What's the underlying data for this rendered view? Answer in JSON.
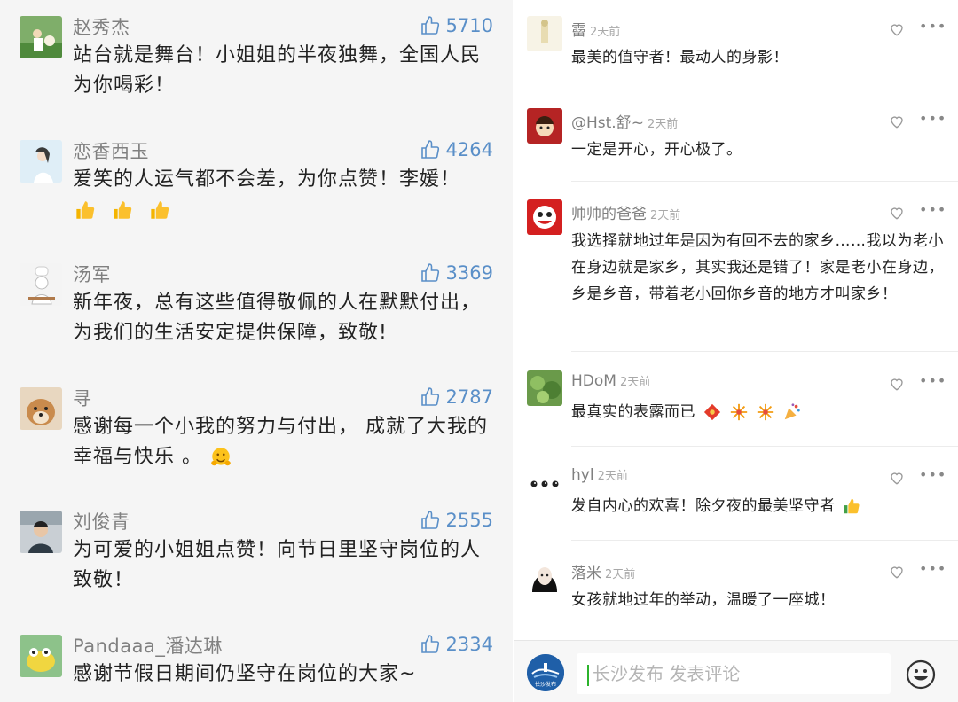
{
  "left": {
    "comments": [
      {
        "name": "赵秀杰",
        "likes": "5710",
        "text": "站台就是舞台！小姐姐的半夜独舞，全国人民为你喝彩！"
      },
      {
        "name": "恋香西玉",
        "likes": "4264",
        "text": "爱笑的人运气都不会差，为你点赞！李媛！",
        "emojis": [
          "thumbs-up-emoji",
          "thumbs-up-emoji",
          "thumbs-up-emoji"
        ]
      },
      {
        "name": "汤军",
        "likes": "3369",
        "text": "新年夜，总有这些值得敬佩的人在默默付出，为我们的生活安定提供保障，致敬!"
      },
      {
        "name": "寻",
        "likes": "2787",
        "text": "感谢每一个小我的努力与付出， 成就了大我的幸福与快乐 。",
        "emojis": [
          "hugging-face-emoji"
        ]
      },
      {
        "name": "刘俊青",
        "likes": "2555",
        "text": "为可爱的小姐姐点赞！向节日里坚守岗位的人致敬！"
      },
      {
        "name": "Pandaaa_潘达琳",
        "likes": "2334",
        "text": "感谢节假日期间仍坚守在岗位的大家~"
      }
    ]
  },
  "right": {
    "comments": [
      {
        "name": "霤",
        "time": "2天前",
        "text": "最美的值守者！最动人的身影！"
      },
      {
        "name": "@Hst.舒~",
        "time": "2天前",
        "text": "一定是开心，开心极了。"
      },
      {
        "name": "帅帅的爸爸",
        "time": "2天前",
        "text": "我选择就地过年是因为有回不去的家乡……我以为老小在身边就是家乡，其实我还是错了！家是老小在身边，乡是乡音，带着老小回你乡音的地方才叫家乡！"
      },
      {
        "name": "HDoM",
        "time": "2天前",
        "text": "最真实的表露而已",
        "emojis": [
          "red-packet-emoji",
          "firework-emoji",
          "firework-emoji",
          "party-popper-emoji"
        ]
      },
      {
        "name": "hyl",
        "time": "2天前",
        "text": "发自内心的欢喜！除夕夜的最美坚守者",
        "emojis": [
          "thumbs-up-emoji"
        ]
      },
      {
        "name": "落米",
        "time": "2天前",
        "text": "女孩就地过年的举动，温暖了一座城！"
      }
    ]
  },
  "bottom": {
    "placeholder": "长沙发布 发表评论",
    "logo_text": "长沙发布"
  },
  "colors": {
    "accent": "#5a8fc8",
    "cursor": "#2cb32c"
  }
}
